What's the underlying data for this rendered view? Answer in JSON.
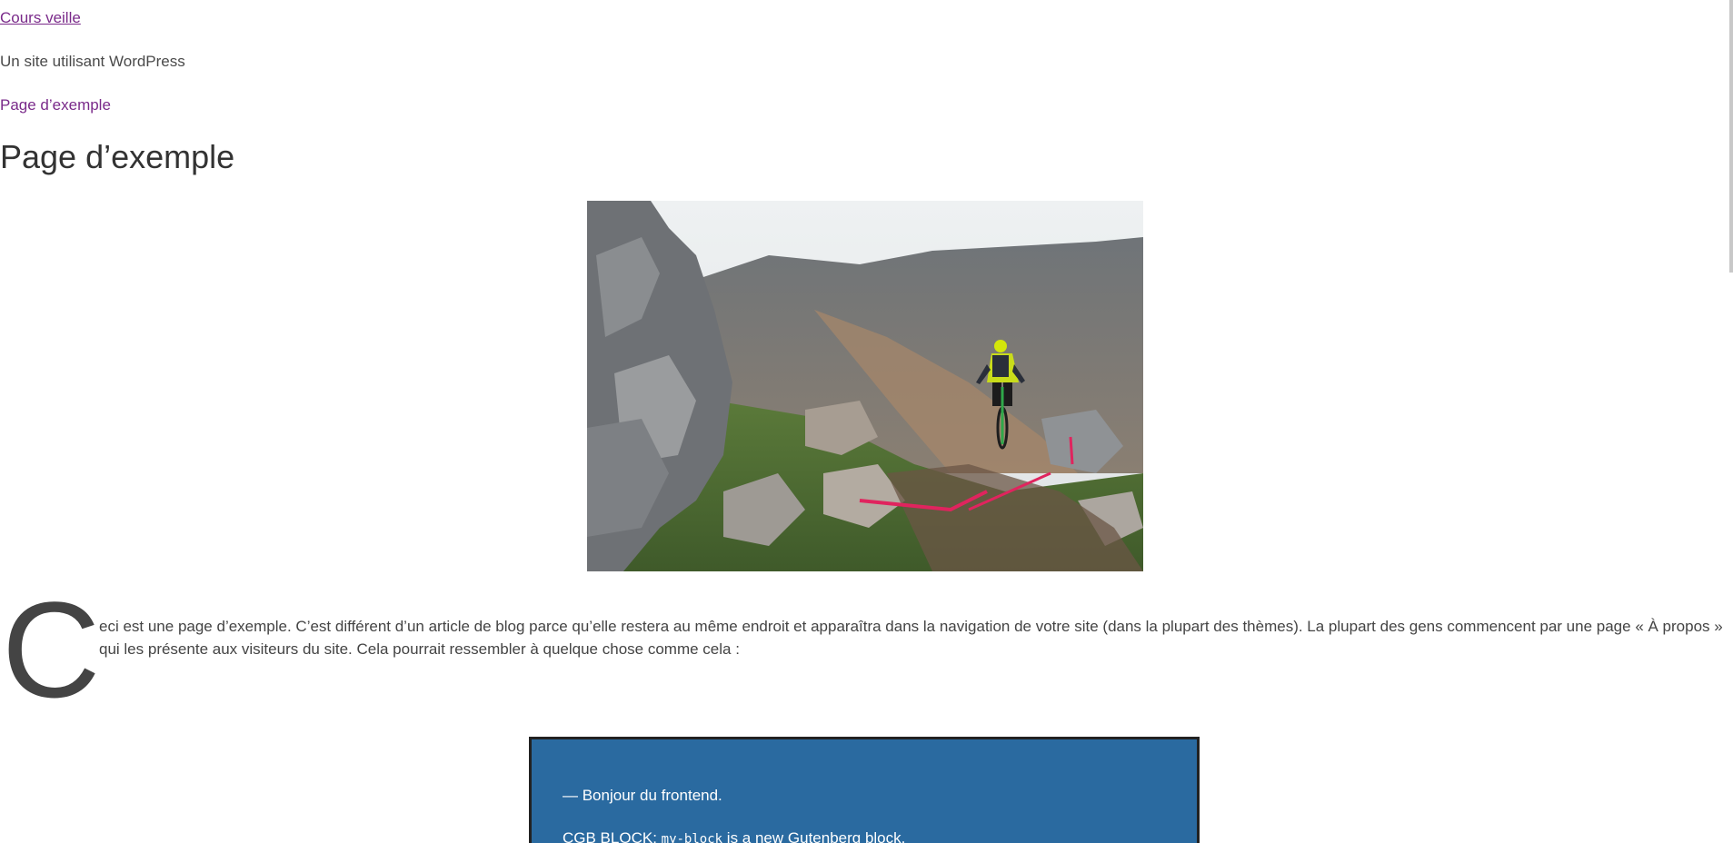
{
  "header": {
    "site_title": "Cours veille",
    "site_description": "Un site utilisant WordPress",
    "nav_link": "Page d’exemple"
  },
  "main": {
    "page_title": "Page d’exemple",
    "intro_dropcap": "C",
    "intro_text": "eci est une page d’exemple. C’est différent d’un article de blog parce qu’elle restera au même endroit et apparaîtra dans la navigation de votre site (dans la plupart des thèmes). La plupart des gens commencent par une page « À propos » qui les présente aux visiteurs du site. Cela pourrait ressembler à quelque chose comme cela :",
    "block": {
      "line1": "— Bonjour du frontend.",
      "line2_prefix": "CGB BLOCK: ",
      "line2_code": "my-block",
      "line2_suffix": " is a new Gutenberg block."
    }
  },
  "colors": {
    "link": "#7a2a8a",
    "block_bg": "#2a6aa0",
    "text": "#444444"
  }
}
